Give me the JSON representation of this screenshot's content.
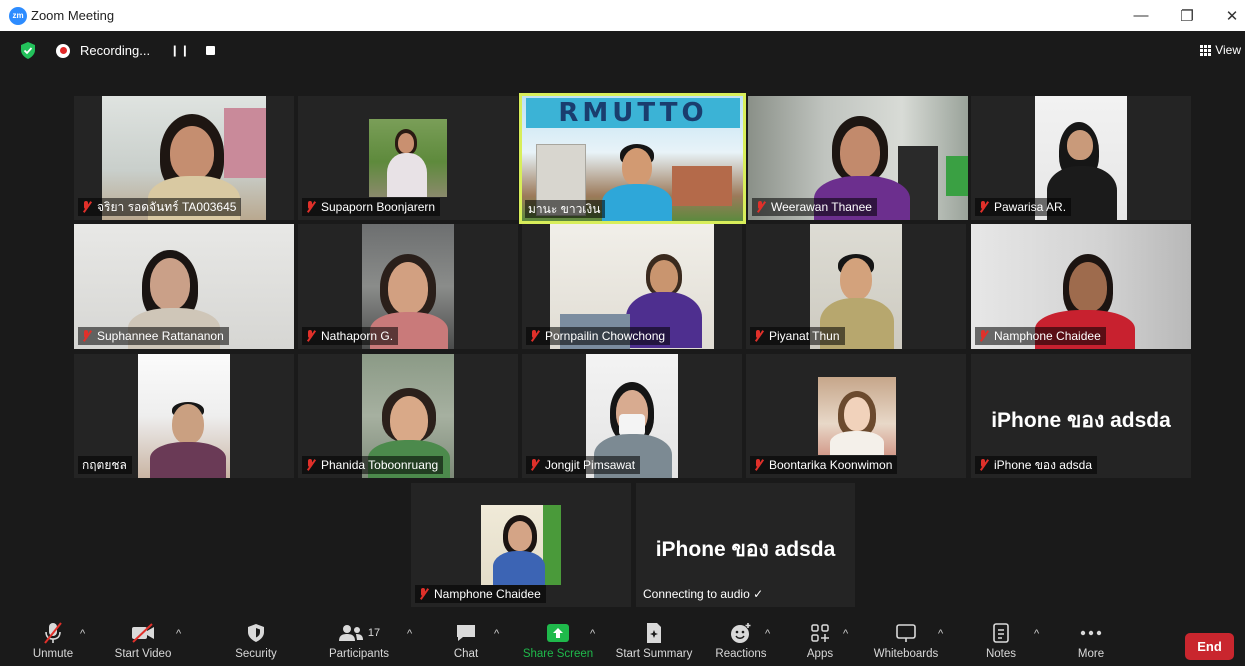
{
  "window": {
    "title": "Zoom Meeting",
    "logo_text": "zm",
    "controls": {
      "minimize": "—",
      "restore": "❐",
      "close": "✕"
    }
  },
  "top_bar": {
    "recording_label": "Recording...",
    "pause_icon": "❙❙",
    "view_label": "View"
  },
  "participants": [
    {
      "name": "จริยา รอดจันทร์ TA003645",
      "muted": true
    },
    {
      "name": "Supaporn Boonjarern",
      "muted": true
    },
    {
      "name": "มานะ ขาวเงิน",
      "muted": false,
      "active_speaker": true,
      "background_text": "RMUTTO"
    },
    {
      "name": "Weerawan Thanee",
      "muted": true
    },
    {
      "name": "Pawarisa AR.",
      "muted": true
    },
    {
      "name": "Suphannee Rattananon",
      "muted": true
    },
    {
      "name": "Nathaporn G.",
      "muted": true
    },
    {
      "name": "Pornpailin Chowchong",
      "muted": true
    },
    {
      "name": "Piyanat Thun",
      "muted": true
    },
    {
      "name": "Namphone Chaidee",
      "muted": true
    },
    {
      "name": "กฤตยชล",
      "muted": false
    },
    {
      "name": "Phanida Toboonruang",
      "muted": true
    },
    {
      "name": "Jongjit Pimsawat",
      "muted": true
    },
    {
      "name": "Boontarika Koonwimon",
      "muted": true
    },
    {
      "name": "iPhone ของ adsda",
      "muted": true,
      "display_text": "iPhone ของ adsda"
    },
    {
      "name": "Namphone Chaidee",
      "muted": true
    },
    {
      "name": "Connecting to audio ✓",
      "muted": false,
      "display_text": "iPhone ของ adsda"
    }
  ],
  "toolbar": {
    "unmute": "Unmute",
    "start_video": "Start Video",
    "security": "Security",
    "participants": "Participants",
    "participants_count": "17",
    "chat": "Chat",
    "share_screen": "Share Screen",
    "start_summary": "Start Summary",
    "reactions": "Reactions",
    "apps": "Apps",
    "whiteboards": "Whiteboards",
    "notes": "Notes",
    "more": "More",
    "end": "End"
  },
  "colors": {
    "background": "#1a1a1a",
    "tile": "#242424",
    "active_speaker_border": "#d8ee5a",
    "share_green": "#1fb94b",
    "end_red": "#c9262e",
    "muted_red": "#e0302a"
  },
  "icons": [
    "shield-icon",
    "mic-muted-icon",
    "video-off-icon",
    "security-shield-icon",
    "participants-icon",
    "chat-icon",
    "share-screen-icon",
    "summary-icon",
    "reactions-icon",
    "apps-icon",
    "whiteboard-icon",
    "notes-icon",
    "more-icon"
  ]
}
